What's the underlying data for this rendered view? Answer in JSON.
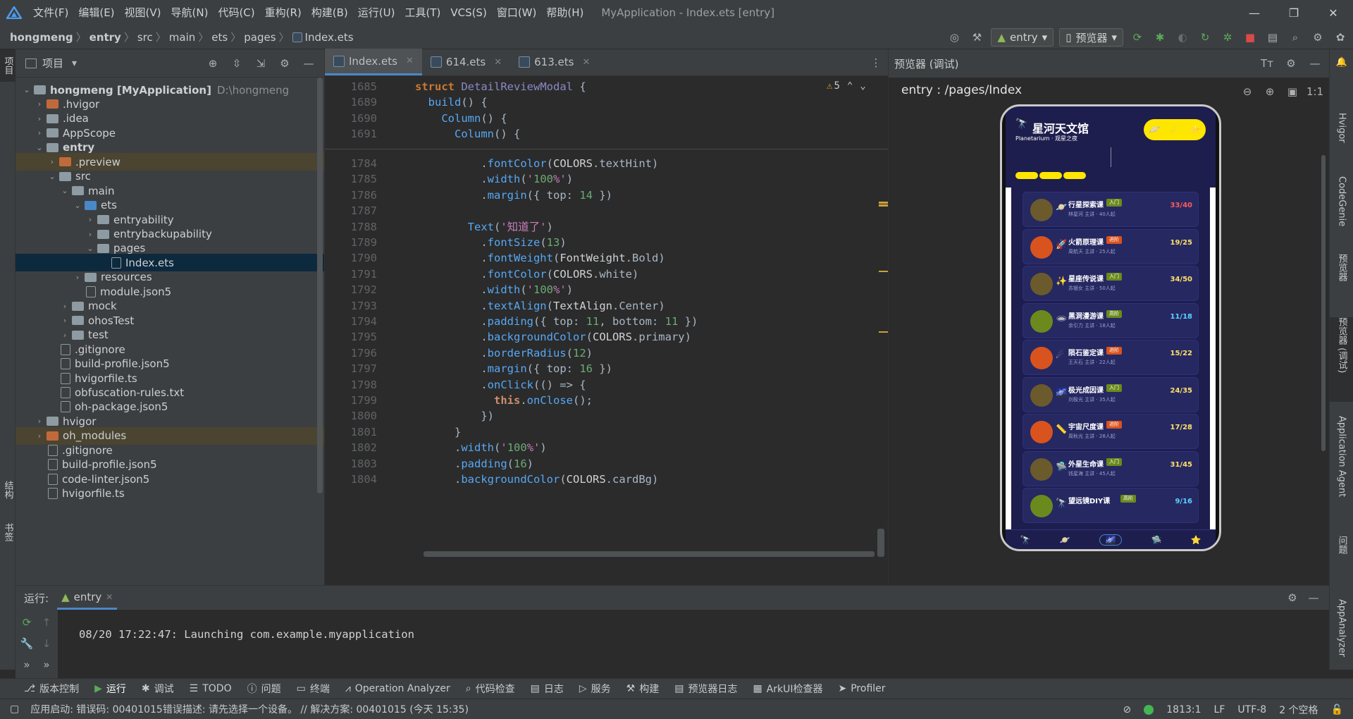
{
  "titlebar": {
    "menu": [
      "文件(F)",
      "编辑(E)",
      "视图(V)",
      "导航(N)",
      "代码(C)",
      "重构(R)",
      "构建(B)",
      "运行(U)",
      "工具(T)",
      "VCS(S)",
      "窗口(W)",
      "帮助(H)"
    ],
    "window_title": "MyApplication - Index.ets [entry]",
    "minimize": "—",
    "maximize": "❐",
    "close": "✕"
  },
  "breadcrumb": [
    "hongmeng",
    "entry",
    "src",
    "main",
    "ets",
    "pages",
    "Index.ets"
  ],
  "toolbar": {
    "run_config": "entry",
    "device": "预览器"
  },
  "project_panel": {
    "title": "项目",
    "tree": [
      {
        "label": "hongmeng [MyApplication]",
        "hint": "D:\\hongmeng",
        "type": "folder",
        "expanded": true
      },
      {
        "label": ".hvigor",
        "type": "folder-orange",
        "expanded": false
      },
      {
        "label": ".idea",
        "type": "folder",
        "expanded": false
      },
      {
        "label": "AppScope",
        "type": "folder",
        "expanded": false
      },
      {
        "label": "entry",
        "type": "folder",
        "expanded": true
      },
      {
        "label": ".preview",
        "type": "folder-orange",
        "expanded": false
      },
      {
        "label": "src",
        "type": "folder",
        "expanded": true
      },
      {
        "label": "main",
        "type": "folder",
        "expanded": true
      },
      {
        "label": "ets",
        "type": "folder-blue",
        "expanded": true
      },
      {
        "label": "entryability",
        "type": "folder",
        "expanded": false
      },
      {
        "label": "entrybackupability",
        "type": "folder",
        "expanded": false
      },
      {
        "label": "pages",
        "type": "folder",
        "expanded": true
      },
      {
        "label": "Index.ets",
        "type": "file"
      },
      {
        "label": "resources",
        "type": "folder",
        "expanded": false
      },
      {
        "label": "module.json5",
        "type": "file"
      },
      {
        "label": "mock",
        "type": "folder",
        "expanded": false
      },
      {
        "label": "ohosTest",
        "type": "folder",
        "expanded": false
      },
      {
        "label": "test",
        "type": "folder",
        "expanded": false
      },
      {
        "label": ".gitignore",
        "type": "file"
      },
      {
        "label": "build-profile.json5",
        "type": "file"
      },
      {
        "label": "hvigorfile.ts",
        "type": "file"
      },
      {
        "label": "obfuscation-rules.txt",
        "type": "file"
      },
      {
        "label": "oh-package.json5",
        "type": "file"
      },
      {
        "label": "hvigor",
        "type": "folder",
        "expanded": false
      },
      {
        "label": "oh_modules",
        "type": "folder-orange",
        "expanded": false
      },
      {
        "label": ".gitignore",
        "type": "file"
      },
      {
        "label": "build-profile.json5",
        "type": "file"
      },
      {
        "label": "code-linter.json5",
        "type": "file"
      },
      {
        "label": "hvigorfile.ts",
        "type": "file"
      }
    ]
  },
  "editor": {
    "tabs": [
      {
        "label": "Index.ets",
        "active": true
      },
      {
        "label": "614.ets",
        "active": false
      },
      {
        "label": "613.ets",
        "active": false
      }
    ],
    "warnings": "5",
    "sticky_lines": [
      {
        "n": "1685",
        "code": "struct DetailReviewModal {"
      },
      {
        "n": "1689",
        "code": "  build() {"
      },
      {
        "n": "1690",
        "code": "    Column() {"
      },
      {
        "n": "1691",
        "code": "      Column() {"
      }
    ],
    "lines": [
      {
        "n": "1784",
        "code": "          .fontColor(COLORS.textHint)"
      },
      {
        "n": "1785",
        "code": "          .width('100%')"
      },
      {
        "n": "1786",
        "code": "          .margin({ top: 14 })"
      },
      {
        "n": "1787",
        "code": ""
      },
      {
        "n": "1788",
        "code": "        Text('知道了')"
      },
      {
        "n": "1789",
        "code": "          .fontSize(13)"
      },
      {
        "n": "1790",
        "code": "          .fontWeight(FontWeight.Bold)"
      },
      {
        "n": "1791",
        "code": "          .fontColor(COLORS.white)"
      },
      {
        "n": "1792",
        "code": "          .width('100%')"
      },
      {
        "n": "1793",
        "code": "          .textAlign(TextAlign.Center)"
      },
      {
        "n": "1794",
        "code": "          .padding({ top: 11, bottom: 11 })"
      },
      {
        "n": "1795",
        "code": "          .backgroundColor(COLORS.primary)"
      },
      {
        "n": "1796",
        "code": "          .borderRadius(12)"
      },
      {
        "n": "1797",
        "code": "          .margin({ top: 16 })"
      },
      {
        "n": "1798",
        "code": "          .onClick(() => {"
      },
      {
        "n": "1799",
        "code": "            this.onClose();"
      },
      {
        "n": "1800",
        "code": "          })"
      },
      {
        "n": "1801",
        "code": "      }"
      },
      {
        "n": "1802",
        "code": "      .width('100%')"
      },
      {
        "n": "1803",
        "code": "      .padding(16)"
      },
      {
        "n": "1804",
        "code": "      .backgroundColor(COLORS.cardBg)"
      }
    ]
  },
  "preview": {
    "title": "预览器 (调试)",
    "route": "entry : /pages/Index",
    "app": {
      "title": "星河天文馆",
      "subtitle": "Planetarium · 观星之夜",
      "courses": [
        {
          "name": "行星探索课",
          "tag": "入门",
          "tag_color": "#6b8a1d",
          "sub": "林星河 主讲 · 40人起",
          "count": "33/40",
          "count_color": "#ff5a5a",
          "icon": "🪐",
          "avatar": "#6b5a2c"
        },
        {
          "name": "火箭原理课",
          "tag": "进阶",
          "tag_color": "#d9531e",
          "sub": "周航天 主讲 · 25人起",
          "count": "19/25",
          "count_color": "#ffe066",
          "icon": "🚀",
          "avatar": "#d9531e"
        },
        {
          "name": "星座传说课",
          "tag": "入门",
          "tag_color": "#6b8a1d",
          "sub": "苏银女 主讲 · 50人起",
          "count": "34/50",
          "count_color": "#ffe066",
          "icon": "✨",
          "avatar": "#6b5a2c"
        },
        {
          "name": "黑洞漫游课",
          "tag": "高阶",
          "tag_color": "#6b8a1d",
          "sub": "余引力 主讲 · 18人起",
          "count": "11/18",
          "count_color": "#5ad3ff",
          "icon": "🕳",
          "avatar": "#6b8a1d"
        },
        {
          "name": "陨石鉴定课",
          "tag": "进阶",
          "tag_color": "#d9531e",
          "sub": "王天石 主讲 · 22人起",
          "count": "15/22",
          "count_color": "#ffe066",
          "icon": "☄",
          "avatar": "#d9531e"
        },
        {
          "name": "极光成因课",
          "tag": "入门",
          "tag_color": "#6b8a1d",
          "sub": "刘极光 主讲 · 35人起",
          "count": "24/35",
          "count_color": "#ffe066",
          "icon": "🌌",
          "avatar": "#6b5a2c"
        },
        {
          "name": "宇宙尺度课",
          "tag": "进阶",
          "tag_color": "#d9531e",
          "sub": "周秋光 主讲 · 28人起",
          "count": "17/28",
          "count_color": "#ffe066",
          "icon": "📏",
          "avatar": "#d9531e"
        },
        {
          "name": "外星生命课",
          "tag": "入门",
          "tag_color": "#6b8a1d",
          "sub": "钱星海 主讲 · 45人起",
          "count": "31/45",
          "count_color": "#ffe066",
          "icon": "🛸",
          "avatar": "#6b5a2c"
        },
        {
          "name": "望远镜DIY课",
          "tag": "高阶",
          "tag_color": "#6b8a1d",
          "sub": "",
          "count": "9/16",
          "count_color": "#5ad3ff",
          "icon": "🔭",
          "avatar": "#6b8a1d"
        }
      ],
      "tabbar": [
        "🔭",
        "🪐",
        "🌌",
        "🛸",
        "⭐"
      ]
    }
  },
  "right_stripe": [
    "Hvigor",
    "CodeGenie",
    "预览器",
    "预览器 (调试)",
    "Application Agent",
    "问题",
    "AppAnalyzer"
  ],
  "left_stripe": [
    "项目",
    "结构",
    "书签"
  ],
  "run_panel": {
    "label": "运行:",
    "tab": "entry",
    "output": "08/20 17:22:47: Launching com.example.myapplication"
  },
  "tool_tabs": [
    "版本控制",
    "运行",
    "调试",
    "TODO",
    "问题",
    "终端",
    "Operation Analyzer",
    "代码检查",
    "日志",
    "服务",
    "构建",
    "预览器日志",
    "ArkUI检查器",
    "Profiler"
  ],
  "statusbar": {
    "message": "应用启动: 错误码: 00401015错误描述: 请先选择一个设备。 // 解决方案: 00401015 (今天 15:35)",
    "position": "1813:1",
    "line_sep": "LF",
    "encoding": "UTF-8",
    "indent": "2 个空格"
  },
  "colors": {
    "accent": "#4a88c7",
    "app_bg": "#1d1e4d",
    "app_yellow": "#ffe600"
  }
}
